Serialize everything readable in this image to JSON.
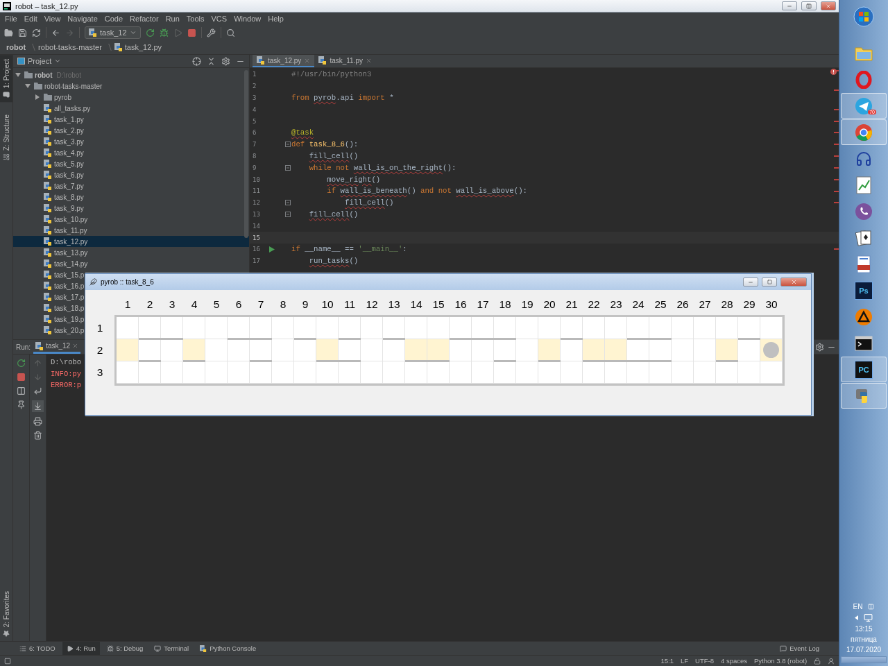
{
  "window": {
    "title": "robot – task_12.py"
  },
  "menu": [
    "File",
    "Edit",
    "View",
    "Navigate",
    "Code",
    "Refactor",
    "Run",
    "Tools",
    "VCS",
    "Window",
    "Help"
  ],
  "toolbar": {
    "run_config": "task_12"
  },
  "breadcrumbs": [
    "robot",
    "robot-tasks-master",
    "task_12.py"
  ],
  "side_tabs_top": [
    {
      "label": "1: Project",
      "kind": "project",
      "selected": true
    },
    {
      "label": "Z: Structure",
      "kind": "structure",
      "selected": false
    }
  ],
  "side_tabs_bottom": [
    {
      "label": "2: Favorites",
      "kind": "favorites",
      "selected": false
    }
  ],
  "project": {
    "title": "Project",
    "tree": [
      {
        "label": "robot",
        "hint": "D:\\robot",
        "kind": "folder",
        "expanded": true,
        "selected": false,
        "children": [
          {
            "label": "robot-tasks-master",
            "kind": "folder",
            "expanded": true,
            "selected": false,
            "children": [
              {
                "label": "pyrob",
                "kind": "folder",
                "expanded": false,
                "selected": false
              },
              {
                "label": "all_tasks.py",
                "kind": "file",
                "selected": false
              },
              {
                "label": "task_1.py",
                "kind": "file",
                "selected": false
              },
              {
                "label": "task_2.py",
                "kind": "file",
                "selected": false
              },
              {
                "label": "task_3.py",
                "kind": "file",
                "selected": false
              },
              {
                "label": "task_4.py",
                "kind": "file",
                "selected": false
              },
              {
                "label": "task_5.py",
                "kind": "file",
                "selected": false
              },
              {
                "label": "task_6.py",
                "kind": "file",
                "selected": false
              },
              {
                "label": "task_7.py",
                "kind": "file",
                "selected": false
              },
              {
                "label": "task_8.py",
                "kind": "file",
                "selected": false
              },
              {
                "label": "task_9.py",
                "kind": "file",
                "selected": false
              },
              {
                "label": "task_10.py",
                "kind": "file",
                "selected": false
              },
              {
                "label": "task_11.py",
                "kind": "file",
                "selected": false
              },
              {
                "label": "task_12.py",
                "kind": "file",
                "selected": true
              },
              {
                "label": "task_13.py",
                "kind": "file",
                "selected": false
              },
              {
                "label": "task_14.py",
                "kind": "file",
                "selected": false
              },
              {
                "label": "task_15.p",
                "kind": "file",
                "selected": false
              },
              {
                "label": "task_16.p",
                "kind": "file",
                "selected": false
              },
              {
                "label": "task_17.p",
                "kind": "file",
                "selected": false
              },
              {
                "label": "task_18.p",
                "kind": "file",
                "selected": false
              },
              {
                "label": "task_19.p",
                "kind": "file",
                "selected": false
              },
              {
                "label": "task_20.p",
                "kind": "file",
                "selected": false
              }
            ]
          }
        ]
      }
    ]
  },
  "editor": {
    "tabs": [
      {
        "label": "task_12.py",
        "selected": true
      },
      {
        "label": "task_11.py",
        "selected": false
      }
    ],
    "lines": [
      {
        "number": "1",
        "foldable": false,
        "runnable": false,
        "current": false,
        "tokens": [
          {
            "text": "#!/usr/bin/python3",
            "kind": "comment"
          }
        ]
      },
      {
        "number": "2",
        "foldable": false,
        "runnable": false,
        "current": false
      },
      {
        "number": "3",
        "foldable": false,
        "runnable": false,
        "current": false,
        "tokens": [
          {
            "text": "from ",
            "kind": "keyword"
          },
          {
            "text": "pyrob",
            "kind": "unresolved"
          },
          {
            "text": ".api ",
            "kind": "plain"
          },
          {
            "text": "import",
            "kind": "keyword"
          },
          {
            "text": " *",
            "kind": "plain"
          }
        ]
      },
      {
        "number": "4",
        "foldable": false,
        "runnable": false,
        "current": false
      },
      {
        "number": "5",
        "foldable": false,
        "runnable": false,
        "current": false
      },
      {
        "number": "6",
        "foldable": false,
        "runnable": false,
        "current": false,
        "tokens": [
          {
            "text": "@task",
            "kind": "unresolved-decorator"
          }
        ]
      },
      {
        "number": "7",
        "foldable": true,
        "runnable": false,
        "current": false,
        "tokens": [
          {
            "text": "def ",
            "kind": "keyword"
          },
          {
            "text": "task_8_6",
            "kind": "function"
          },
          {
            "text": "():",
            "kind": "plain"
          }
        ]
      },
      {
        "number": "8",
        "foldable": false,
        "runnable": false,
        "current": false,
        "tokens": [
          {
            "text": "    fill_cell",
            "kind": "unresolved"
          },
          {
            "text": "()",
            "kind": "plain"
          }
        ]
      },
      {
        "number": "9",
        "foldable": true,
        "runnable": false,
        "current": false,
        "tokens": [
          {
            "text": "    while not ",
            "kind": "keyword"
          },
          {
            "text": "wall_is_on_the_right",
            "kind": "unresolved"
          },
          {
            "text": "():",
            "kind": "plain"
          }
        ]
      },
      {
        "number": "10",
        "foldable": false,
        "runnable": false,
        "current": false,
        "tokens": [
          {
            "text": "        move_right",
            "kind": "unresolved"
          },
          {
            "text": "()",
            "kind": "plain"
          }
        ]
      },
      {
        "number": "11",
        "foldable": false,
        "runnable": false,
        "current": false,
        "tokens": [
          {
            "text": "        if ",
            "kind": "keyword"
          },
          {
            "text": "wall_is_beneath",
            "kind": "unresolved"
          },
          {
            "text": "() ",
            "kind": "plain"
          },
          {
            "text": "and not ",
            "kind": "keyword"
          },
          {
            "text": "wall_is_above",
            "kind": "unresolved"
          },
          {
            "text": "():",
            "kind": "plain"
          }
        ]
      },
      {
        "number": "12",
        "foldable": true,
        "runnable": false,
        "current": false,
        "tokens": [
          {
            "text": "            fill_cell",
            "kind": "unresolved"
          },
          {
            "text": "()",
            "kind": "plain"
          }
        ]
      },
      {
        "number": "13",
        "foldable": true,
        "runnable": false,
        "current": false,
        "tokens": [
          {
            "text": "    fill_cell",
            "kind": "unresolved"
          },
          {
            "text": "()",
            "kind": "plain"
          }
        ]
      },
      {
        "number": "14",
        "foldable": false,
        "runnable": false,
        "current": false
      },
      {
        "number": "15",
        "foldable": false,
        "runnable": false,
        "current": true
      },
      {
        "number": "16",
        "foldable": false,
        "runnable": true,
        "current": false,
        "tokens": [
          {
            "text": "if",
            "kind": "keyword"
          },
          {
            "text": " __name__ == ",
            "kind": "plain"
          },
          {
            "text": "'__main__'",
            "kind": "string"
          },
          {
            "text": ":",
            "kind": "plain"
          }
        ]
      },
      {
        "number": "17",
        "foldable": false,
        "runnable": false,
        "current": false,
        "tokens": [
          {
            "text": "    run_tasks",
            "kind": "unresolved"
          },
          {
            "text": "()",
            "kind": "plain"
          }
        ]
      }
    ]
  },
  "run": {
    "label": "Run:",
    "tabs": [
      {
        "label": "task_12",
        "selected": true
      }
    ],
    "console": [
      {
        "text": "D:\\robo",
        "kind": "normal"
      },
      {
        "text": "INFO:py",
        "kind": "error"
      },
      {
        "text": "ERROR:p",
        "kind": "error"
      }
    ]
  },
  "tool_windows": [
    {
      "label": "6: TODO",
      "kind": "todo",
      "selected": false
    },
    {
      "label": "4: Run",
      "kind": "run",
      "selected": true
    },
    {
      "label": "5: Debug",
      "kind": "debug",
      "selected": false
    },
    {
      "label": "Terminal",
      "kind": "terminal",
      "selected": false
    },
    {
      "label": "Python Console",
      "kind": "console",
      "selected": false
    }
  ],
  "event_log": "Event Log",
  "status_bar": [
    "15:1",
    "LF",
    "UTF-8",
    "4 spaces",
    "Python 3.8 (robot)"
  ],
  "robot_window": {
    "title": "pyrob :: task_8_6",
    "columns": [
      "1",
      "2",
      "3",
      "4",
      "5",
      "6",
      "7",
      "8",
      "9",
      "10",
      "11",
      "12",
      "13",
      "14",
      "15",
      "16",
      "17",
      "18",
      "19",
      "20",
      "21",
      "22",
      "23",
      "24",
      "25",
      "26",
      "27",
      "28",
      "29",
      "30"
    ],
    "rows": [
      {
        "label": "1",
        "cells": [
          {
            "filled": false,
            "wall_below": false,
            "robot": false
          },
          {
            "filled": false,
            "wall_below": true,
            "robot": false
          },
          {
            "filled": false,
            "wall_below": true,
            "robot": false
          },
          {
            "filled": false,
            "wall_below": false,
            "robot": false
          },
          {
            "filled": false,
            "wall_below": false,
            "robot": false
          },
          {
            "filled": false,
            "wall_below": true,
            "robot": false
          },
          {
            "filled": false,
            "wall_below": true,
            "robot": false
          },
          {
            "filled": false,
            "wall_below": false,
            "robot": false
          },
          {
            "filled": false,
            "wall_below": true,
            "robot": false
          },
          {
            "filled": false,
            "wall_below": false,
            "robot": false
          },
          {
            "filled": false,
            "wall_below": true,
            "robot": false
          },
          {
            "filled": false,
            "wall_below": false,
            "robot": false
          },
          {
            "filled": false,
            "wall_below": true,
            "robot": false
          },
          {
            "filled": false,
            "wall_below": false,
            "robot": false
          },
          {
            "filled": false,
            "wall_below": false,
            "robot": false
          },
          {
            "filled": false,
            "wall_below": true,
            "robot": false
          },
          {
            "filled": false,
            "wall_below": true,
            "robot": false
          },
          {
            "filled": false,
            "wall_below": true,
            "robot": false
          },
          {
            "filled": false,
            "wall_below": false,
            "robot": false
          },
          {
            "filled": false,
            "wall_below": false,
            "robot": false
          },
          {
            "filled": false,
            "wall_below": true,
            "robot": false
          },
          {
            "filled": false,
            "wall_below": false,
            "robot": false
          },
          {
            "filled": false,
            "wall_below": false,
            "robot": false
          },
          {
            "filled": false,
            "wall_below": true,
            "robot": false
          },
          {
            "filled": false,
            "wall_below": true,
            "robot": false
          },
          {
            "filled": false,
            "wall_below": false,
            "robot": false
          },
          {
            "filled": false,
            "wall_below": false,
            "robot": false
          },
          {
            "filled": false,
            "wall_below": false,
            "robot": false
          },
          {
            "filled": false,
            "wall_below": true,
            "robot": false
          },
          {
            "filled": false,
            "wall_below": false,
            "robot": false
          }
        ]
      },
      {
        "label": "2",
        "cells": [
          {
            "filled": true,
            "wall_below": false,
            "robot": false
          },
          {
            "filled": false,
            "wall_below": true,
            "robot": false
          },
          {
            "filled": false,
            "wall_below": false,
            "robot": false
          },
          {
            "filled": true,
            "wall_below": true,
            "robot": false
          },
          {
            "filled": false,
            "wall_below": false,
            "robot": false
          },
          {
            "filled": false,
            "wall_below": false,
            "robot": false
          },
          {
            "filled": false,
            "wall_below": true,
            "robot": false
          },
          {
            "filled": false,
            "wall_below": false,
            "robot": false
          },
          {
            "filled": false,
            "wall_below": false,
            "robot": false
          },
          {
            "filled": true,
            "wall_below": true,
            "robot": false
          },
          {
            "filled": false,
            "wall_below": true,
            "robot": false
          },
          {
            "filled": false,
            "wall_below": false,
            "robot": false
          },
          {
            "filled": false,
            "wall_below": false,
            "robot": false
          },
          {
            "filled": true,
            "wall_below": true,
            "robot": false
          },
          {
            "filled": true,
            "wall_below": true,
            "robot": false
          },
          {
            "filled": false,
            "wall_below": false,
            "robot": false
          },
          {
            "filled": false,
            "wall_below": false,
            "robot": false
          },
          {
            "filled": false,
            "wall_below": true,
            "robot": false
          },
          {
            "filled": false,
            "wall_below": false,
            "robot": false
          },
          {
            "filled": true,
            "wall_below": true,
            "robot": false
          },
          {
            "filled": false,
            "wall_below": false,
            "robot": false
          },
          {
            "filled": true,
            "wall_below": true,
            "robot": false
          },
          {
            "filled": true,
            "wall_below": true,
            "robot": false
          },
          {
            "filled": false,
            "wall_below": true,
            "robot": false
          },
          {
            "filled": false,
            "wall_below": true,
            "robot": false
          },
          {
            "filled": false,
            "wall_below": false,
            "robot": false
          },
          {
            "filled": false,
            "wall_below": false,
            "robot": false
          },
          {
            "filled": true,
            "wall_below": true,
            "robot": false
          },
          {
            "filled": false,
            "wall_below": false,
            "robot": false
          },
          {
            "filled": true,
            "wall_below": false,
            "robot": true
          }
        ]
      },
      {
        "label": "3",
        "cells": [
          {
            "filled": false,
            "wall_below": false,
            "robot": false
          },
          {
            "filled": false,
            "wall_below": false,
            "robot": false
          },
          {
            "filled": false,
            "wall_below": false,
            "robot": false
          },
          {
            "filled": false,
            "wall_below": false,
            "robot": false
          },
          {
            "filled": false,
            "wall_below": false,
            "robot": false
          },
          {
            "filled": false,
            "wall_below": false,
            "robot": false
          },
          {
            "filled": false,
            "wall_below": false,
            "robot": false
          },
          {
            "filled": false,
            "wall_below": false,
            "robot": false
          },
          {
            "filled": false,
            "wall_below": false,
            "robot": false
          },
          {
            "filled": false,
            "wall_below": false,
            "robot": false
          },
          {
            "filled": false,
            "wall_below": false,
            "robot": false
          },
          {
            "filled": false,
            "wall_below": false,
            "robot": false
          },
          {
            "filled": false,
            "wall_below": false,
            "robot": false
          },
          {
            "filled": false,
            "wall_below": false,
            "robot": false
          },
          {
            "filled": false,
            "wall_below": false,
            "robot": false
          },
          {
            "filled": false,
            "wall_below": false,
            "robot": false
          },
          {
            "filled": false,
            "wall_below": false,
            "robot": false
          },
          {
            "filled": false,
            "wall_below": false,
            "robot": false
          },
          {
            "filled": false,
            "wall_below": false,
            "robot": false
          },
          {
            "filled": false,
            "wall_below": false,
            "robot": false
          },
          {
            "filled": false,
            "wall_below": false,
            "robot": false
          },
          {
            "filled": false,
            "wall_below": false,
            "robot": false
          },
          {
            "filled": false,
            "wall_below": false,
            "robot": false
          },
          {
            "filled": false,
            "wall_below": false,
            "robot": false
          },
          {
            "filled": false,
            "wall_below": false,
            "robot": false
          },
          {
            "filled": false,
            "wall_below": false,
            "robot": false
          },
          {
            "filled": false,
            "wall_below": false,
            "robot": false
          },
          {
            "filled": false,
            "wall_below": false,
            "robot": false
          },
          {
            "filled": false,
            "wall_below": false,
            "robot": false
          },
          {
            "filled": false,
            "wall_below": false,
            "robot": false
          }
        ]
      }
    ]
  },
  "taskbar": {
    "apps": [
      {
        "kind": "orb",
        "active": false
      },
      {
        "kind": "folder",
        "active": false
      },
      {
        "kind": "ring",
        "active": false
      },
      {
        "kind": "plane",
        "active": true,
        "badge": "70"
      },
      {
        "kind": "tricolor",
        "active": true
      },
      {
        "kind": "headphones",
        "active": false
      },
      {
        "kind": "chart",
        "active": false
      },
      {
        "kind": "phone",
        "active": false
      },
      {
        "kind": "cards",
        "active": false
      },
      {
        "kind": "document",
        "active": false
      },
      {
        "kind": "tile",
        "label": "Ps",
        "color": "#0b1c3a",
        "active": false
      },
      {
        "kind": "triangle",
        "active": false
      },
      {
        "kind": "console",
        "active": false
      },
      {
        "kind": "tile",
        "label": "PC",
        "color": "#111111",
        "active": true
      },
      {
        "kind": "snake",
        "active": true
      }
    ],
    "language": "EN",
    "time": "13:15",
    "day": "пятница",
    "date": "17.07.2020"
  }
}
